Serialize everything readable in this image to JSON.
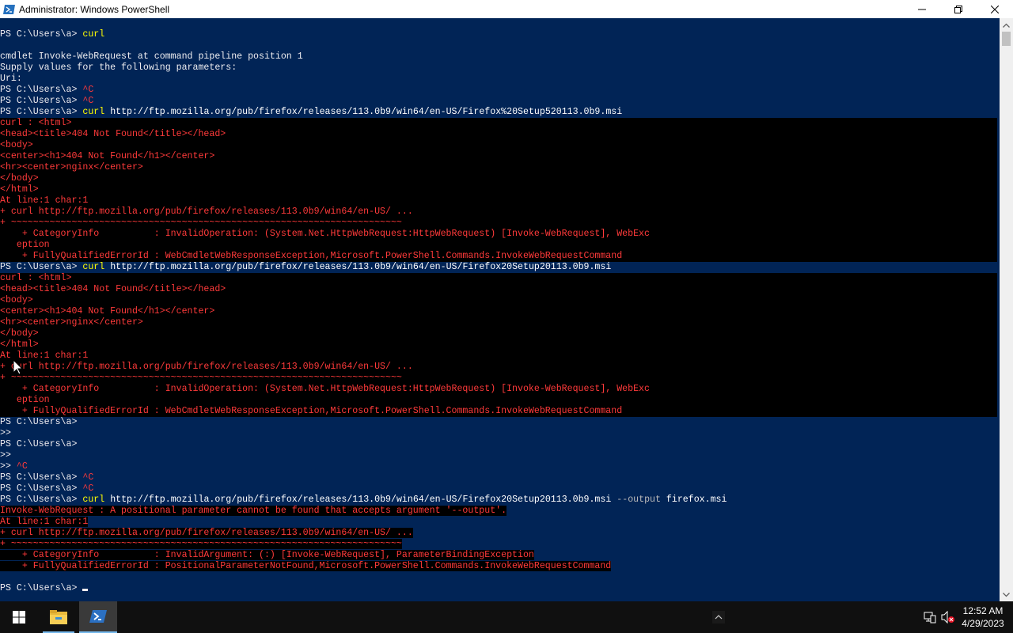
{
  "window": {
    "title": "Administrator: Windows PowerShell",
    "minimize_icon": "minimize-icon",
    "maximize_icon": "restore-icon",
    "close_icon": "close-icon"
  },
  "console": {
    "prompt": "PS C:\\Users\\a>",
    "lines": {
      "l1_cmd": "curl",
      "l3": "cmdlet Invoke-WebRequest at command pipeline position 1",
      "l4": "Supply values for the following parameters:",
      "l5": "Uri:",
      "ctrl_c": "^C",
      "l8_cmd": "curl",
      "l8_arg": "http://ftp.mozilla.org/pub/firefox/releases/113.0b9/win64/en-US/Firefox%20Setup520113.0b9.msi",
      "e1": "curl : <html>",
      "e2": "<head><title>404 Not Found</title></head>",
      "e3": "<body>",
      "e4": "<center><h1>404 Not Found</h1></center>",
      "e5": "<hr><center>nginx</center>",
      "e6": "</body>",
      "e7": "</html>",
      "e8": "At line:1 char:1",
      "e9": "+ curl http://ftp.mozilla.org/pub/firefox/releases/113.0b9/win64/en-US/ ...",
      "e10": "+ ~~~~~~~~~~~~~~~~~~~~~~~~~~~~~~~~~~~~~~~~~~~~~~~~~~~~~~~~~~~~~~~~~~~~~~~",
      "e11": "    + CategoryInfo          : InvalidOperation: (System.Net.HttpWebRequest:HttpWebRequest) [Invoke-WebRequest], WebExc",
      "e12": "   eption",
      "e13": "    + FullyQualifiedErrorId : WebCmdletWebResponseException,Microsoft.PowerShell.Commands.InvokeWebRequestCommand",
      "l22_arg": "http://ftp.mozilla.org/pub/firefox/releases/113.0b9/win64/en-US/Firefox20Setup20113.0b9.msi",
      "cont": ">>",
      "cont_ctrl_c": "^C",
      "l42_arg": "http://ftp.mozilla.org/pub/firefox/releases/113.0b9/win64/en-US/Firefox20Setup20113.0b9.msi",
      "l42_param": "--output",
      "l42_val": "firefox.msi",
      "p1": "Invoke-WebRequest : A positional parameter cannot be found that accepts argument '--output'.",
      "p2": "At line:1 char:1",
      "p3": "+ curl http://ftp.mozilla.org/pub/firefox/releases/113.0b9/win64/en-US/ ...",
      "p4": "+ ~~~~~~~~~~~~~~~~~~~~~~~~~~~~~~~~~~~~~~~~~~~~~~~~~~~~~~~~~~~~~~~~~~~~~~~",
      "p5": "    + CategoryInfo          : InvalidArgument: (:) [Invoke-WebRequest], ParameterBindingException",
      "p6": "    + FullyQualifiedErrorId : PositionalParameterNotFound,Microsoft.PowerShell.Commands.InvokeWebRequestCommand"
    }
  },
  "taskbar": {
    "start_icon": "windows-start-icon",
    "items": [
      {
        "name": "File Explorer",
        "icon": "folder-icon"
      },
      {
        "name": "Windows PowerShell",
        "icon": "powershell-icon",
        "active": true
      }
    ],
    "time": "12:52 AM",
    "date": "4/29/2023"
  },
  "colors": {
    "console_bg": "#012456",
    "console_fg": "#eeedf0",
    "command": "#ffff00",
    "error": "#ff3a3a",
    "error_bg": "#000000",
    "taskbar_bg": "#101010"
  }
}
